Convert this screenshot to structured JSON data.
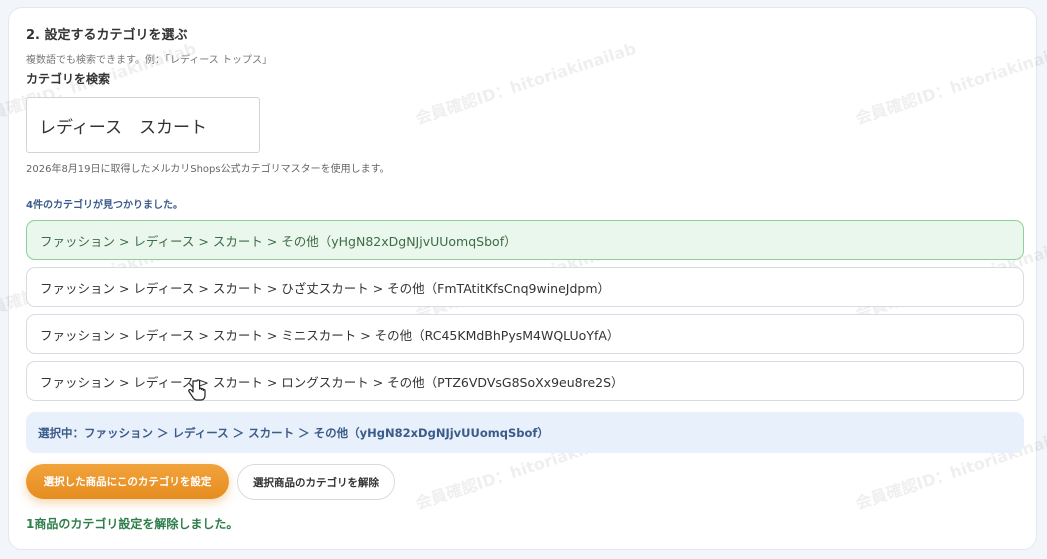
{
  "section": {
    "title": "2. 設定するカテゴリを選ぶ",
    "hint": "複数語でも検索できます。例：「レディース トップス」"
  },
  "search": {
    "label": "カテゴリを検索",
    "value": "レディース　スカート",
    "source_note": "2026年8月19日に取得したメルカリShops公式カテゴリマスターを使用します。"
  },
  "results": {
    "count_text": "4件のカテゴリが見つかりました。",
    "items": [
      {
        "label": "ファッション > レディース > スカート > その他（yHgN82xDgNJjvUUomqSbof）",
        "selected": true
      },
      {
        "label": "ファッション > レディース > スカート > ひざ丈スカート > その他（FmTAtitKfsCnq9wineJdpm）",
        "selected": false
      },
      {
        "label": "ファッション > レディース > スカート > ミニスカート > その他（RC45KMdBhPysM4WQLUoYfA）",
        "selected": false
      },
      {
        "label": "ファッション > レディース > スカート > ロングスカート > その他（PTZ6VDVsG8SoXx9eu8re2S）",
        "selected": false
      }
    ]
  },
  "selection": {
    "text": "選択中：ファッション ＞ レディース ＞ スカート ＞ その他（yHgN82xDgNJjvUUomqSbof）"
  },
  "actions": {
    "apply_label": "選択した商品にこのカテゴリを設定",
    "clear_label": "選択商品のカテゴリを解除"
  },
  "status": {
    "message": "1商品のカテゴリ設定を解除しました。"
  },
  "watermark": {
    "text": "会員確認ID：hitoriakinailab"
  },
  "colors": {
    "accent_orange": "#e58c1f",
    "selected_bg": "#e9f7ec",
    "banner_bg": "#e8f0fb",
    "success_text": "#2e7d4a"
  }
}
